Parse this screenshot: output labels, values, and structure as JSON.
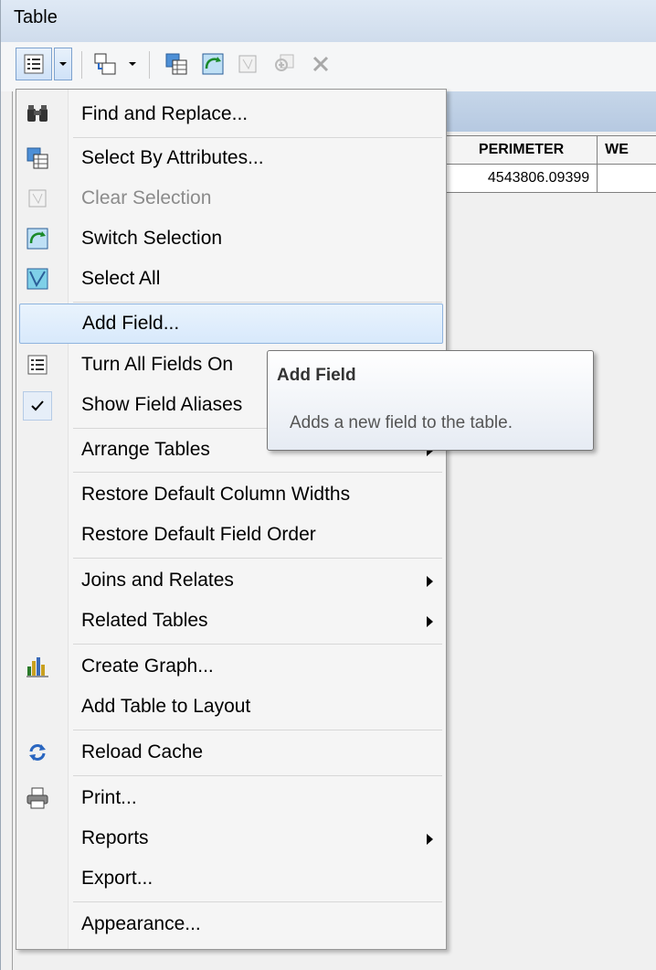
{
  "window": {
    "title": "Table"
  },
  "table": {
    "columns": [
      "PERIMETER",
      "WE"
    ],
    "rows": [
      [
        "4543806.09399",
        ""
      ]
    ]
  },
  "menu": {
    "items": [
      {
        "label": "Find and Replace...",
        "icon": "binoculars-icon"
      },
      {
        "label": "Select By Attributes...",
        "icon": "select-by-attributes-icon"
      },
      {
        "label": "Clear Selection",
        "icon": "clear-selection-icon",
        "disabled": true
      },
      {
        "label": "Switch Selection",
        "icon": "switch-selection-icon"
      },
      {
        "label": "Select All",
        "icon": "select-all-icon"
      },
      {
        "label": "Add Field...",
        "icon": "",
        "highlighted": true
      },
      {
        "label": "Turn All Fields On",
        "icon": "fields-list-icon"
      },
      {
        "label": "Show Field Aliases",
        "icon": "checkmark-icon",
        "checked": true
      },
      {
        "label": "Arrange Tables",
        "submenu": true
      },
      {
        "label": "Restore Default Column Widths"
      },
      {
        "label": "Restore Default Field Order"
      },
      {
        "label": "Joins and Relates",
        "submenu": true
      },
      {
        "label": "Related Tables",
        "submenu": true
      },
      {
        "label": "Create Graph...",
        "icon": "bar-chart-icon"
      },
      {
        "label": "Add Table to Layout"
      },
      {
        "label": "Reload Cache",
        "icon": "refresh-icon"
      },
      {
        "label": "Print...",
        "icon": "printer-icon"
      },
      {
        "label": "Reports",
        "submenu": true
      },
      {
        "label": "Export..."
      },
      {
        "label": "Appearance..."
      }
    ]
  },
  "tooltip": {
    "title": "Add Field",
    "description": "Adds a new field to the table."
  },
  "colors": {
    "highlight": "#d8e9fb",
    "highlight_border": "#8fb4df",
    "titlebar": "#dfe9f5"
  }
}
